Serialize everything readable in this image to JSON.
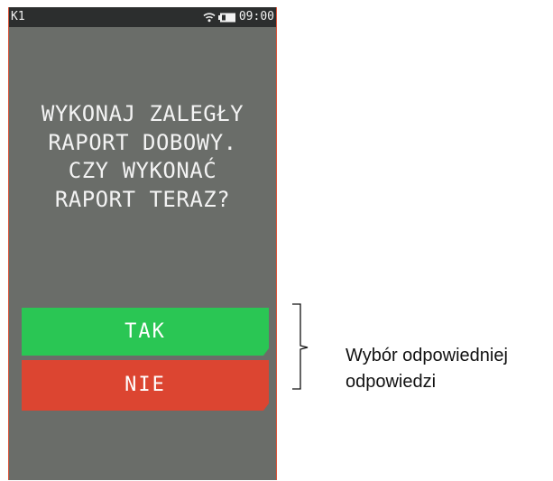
{
  "statusbar": {
    "left_label": "K1",
    "time": "09:00",
    "icons": [
      "wifi-icon",
      "battery-icon"
    ]
  },
  "dialog": {
    "lines": [
      "WYKONAJ ZALEGŁY",
      "RAPORT DOBOWY.",
      "CZY WYKONAĆ",
      "RAPORT TERAZ?"
    ],
    "yes_label": "TAK",
    "no_label": "NIE"
  },
  "annotation": {
    "lines": [
      "Wybór odpowiedniej",
      "odpowiedzi"
    ]
  },
  "colors": {
    "screen_bg": "#6a6d69",
    "statusbar_bg": "#2c2e2e",
    "yes": "#2ac654",
    "no": "#dc4531",
    "frame_accent": "#d9543a"
  }
}
